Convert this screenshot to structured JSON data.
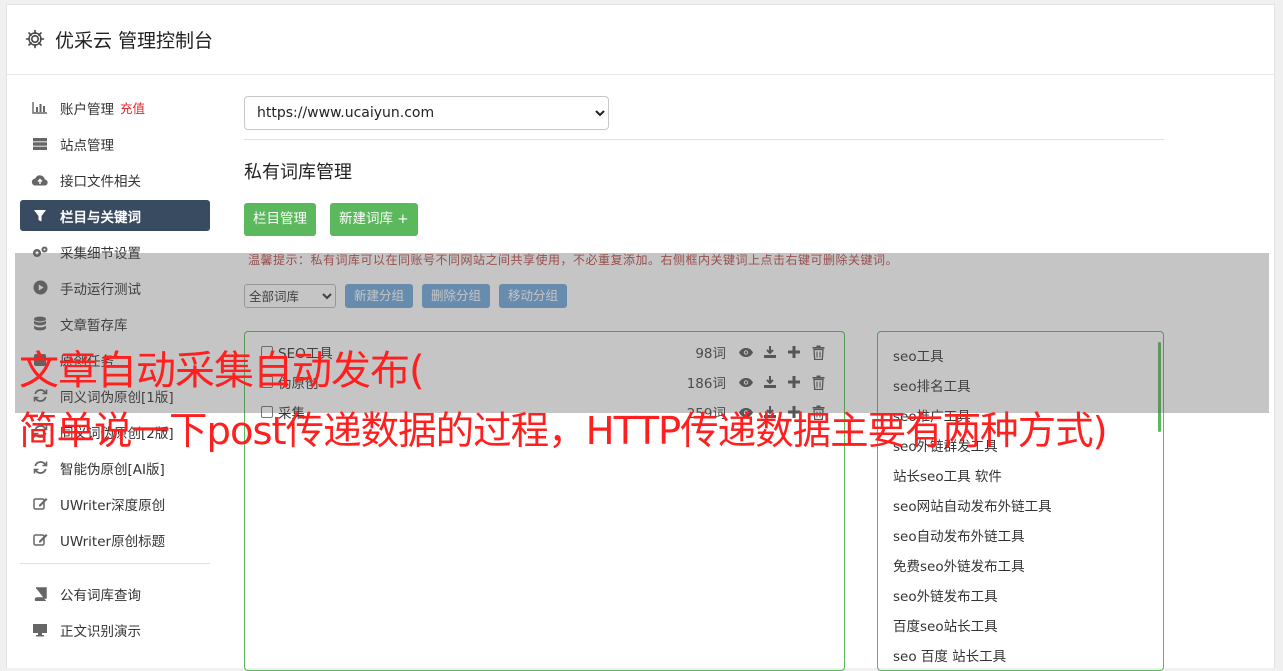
{
  "header": {
    "title": "优采云 管理控制台",
    "icon": "gear-icon"
  },
  "sidebar": {
    "items": [
      {
        "label": "账户管理",
        "badge": "充值",
        "icon": "bar-chart-icon"
      },
      {
        "label": "站点管理",
        "icon": "server-icon"
      },
      {
        "label": "接口文件相关",
        "icon": "cloud-upload-icon"
      },
      {
        "label": "栏目与关键词",
        "icon": "filter-icon",
        "active": true
      },
      {
        "label": "采集细节设置",
        "icon": "gears-icon"
      },
      {
        "label": "手动运行测试",
        "icon": "play-circle-icon"
      },
      {
        "label": "文章暂存库",
        "icon": "database-icon"
      },
      {
        "label": "原创任务",
        "icon": "task-icon"
      },
      {
        "label": "同义词伪原创[1版]",
        "icon": "refresh-icon"
      },
      {
        "label": "同义词伪原创[2版]",
        "icon": "refresh-icon"
      },
      {
        "label": "智能伪原创[AI版]",
        "icon": "refresh-icon"
      },
      {
        "label": "UWriter深度原创",
        "icon": "edit-icon"
      },
      {
        "label": "UWriter原创标题",
        "icon": "edit-icon"
      },
      {
        "label": "公有词库查询",
        "icon": "book-icon"
      },
      {
        "label": "正文识别演示",
        "icon": "monitor-icon"
      }
    ]
  },
  "main": {
    "site_select": {
      "value": "https://www.ucaiyun.com"
    },
    "section_title": "私有词库管理",
    "buttons": {
      "column_manage": "栏目管理",
      "new_library": "新建词库 +"
    },
    "tip": "温馨提示：私有词库可以在同账号不同网站之间共享使用，不必重复添加。右侧框内关键词上点击右键可删除关键词。",
    "toolbar": {
      "group_select": "全部词库",
      "new_group": "新建分组",
      "delete_group": "删除分组",
      "move_group": "移动分组"
    },
    "libraries": [
      {
        "name": "SEO工具",
        "count": "98词"
      },
      {
        "name": "伪原创",
        "count": "186词"
      },
      {
        "name": "采集",
        "count": "259词"
      }
    ],
    "keywords": [
      "seo工具",
      "seo排名工具",
      "seo推广工具",
      "seo外链群发工具",
      "站长seo工具 软件",
      "seo网站自动发布外链工具",
      "seo自动发布外链工具",
      "免费seo外链发布工具",
      "seo外链发布工具",
      "百度seo站长工具",
      "seo 百度 站长工具"
    ]
  },
  "overlay": {
    "line1": "文章自动采集自动发布(",
    "line2": "简单说一下post传递数据的过程，HTTP传递数据主要有两种方式)"
  },
  "colors": {
    "active_nav": "#394b61",
    "green": "#5cb85c",
    "blue": "#6fa8dc",
    "banner_red": "#ff1f1f",
    "charge_red": "#e0262a"
  }
}
